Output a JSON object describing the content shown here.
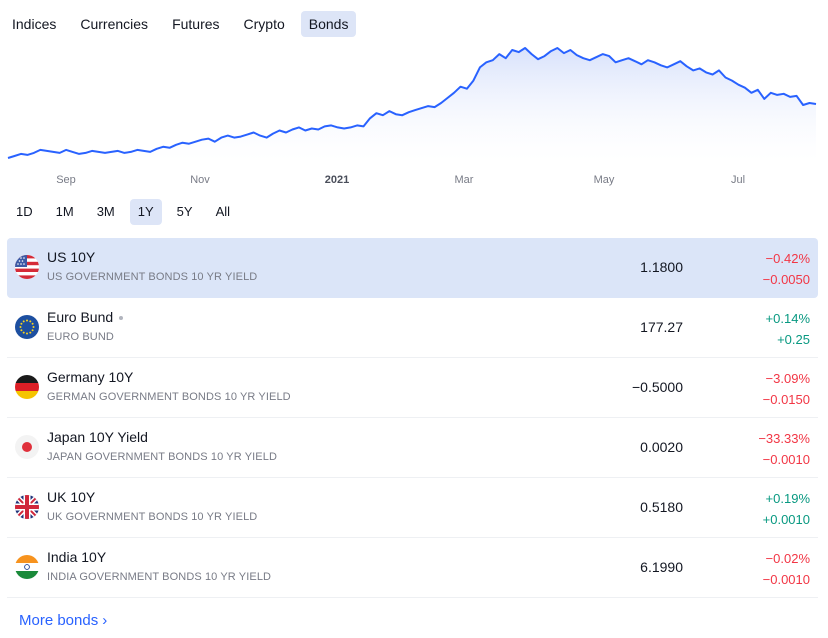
{
  "tabs": [
    {
      "label": "Indices"
    },
    {
      "label": "Currencies"
    },
    {
      "label": "Futures"
    },
    {
      "label": "Crypto"
    },
    {
      "label": "Bonds",
      "active": true
    }
  ],
  "chart_data": {
    "type": "area",
    "x_ticks": [
      "Sep",
      "Nov",
      "2021",
      "Mar",
      "May",
      "Jul"
    ],
    "line_color": "#2962ff",
    "fill_color": "#e8eefc",
    "values": [
      0.66,
      0.68,
      0.7,
      0.69,
      0.71,
      0.74,
      0.73,
      0.72,
      0.71,
      0.74,
      0.72,
      0.7,
      0.71,
      0.73,
      0.72,
      0.71,
      0.72,
      0.73,
      0.71,
      0.72,
      0.74,
      0.73,
      0.72,
      0.75,
      0.77,
      0.76,
      0.79,
      0.81,
      0.8,
      0.82,
      0.84,
      0.85,
      0.82,
      0.86,
      0.88,
      0.86,
      0.87,
      0.89,
      0.91,
      0.88,
      0.86,
      0.9,
      0.93,
      0.91,
      0.94,
      0.96,
      0.93,
      0.95,
      0.94,
      0.97,
      0.98,
      0.96,
      0.95,
      0.96,
      0.98,
      0.97,
      1.05,
      1.1,
      1.08,
      1.12,
      1.09,
      1.08,
      1.11,
      1.13,
      1.15,
      1.17,
      1.16,
      1.2,
      1.25,
      1.3,
      1.36,
      1.34,
      1.42,
      1.55,
      1.6,
      1.62,
      1.68,
      1.64,
      1.72,
      1.7,
      1.74,
      1.68,
      1.63,
      1.66,
      1.71,
      1.74,
      1.69,
      1.72,
      1.67,
      1.64,
      1.62,
      1.65,
      1.68,
      1.66,
      1.6,
      1.62,
      1.64,
      1.61,
      1.58,
      1.62,
      1.6,
      1.57,
      1.55,
      1.58,
      1.61,
      1.56,
      1.52,
      1.54,
      1.5,
      1.48,
      1.52,
      1.45,
      1.42,
      1.38,
      1.35,
      1.3,
      1.33,
      1.24,
      1.3,
      1.28,
      1.29,
      1.26,
      1.27,
      1.18,
      1.2,
      1.19
    ],
    "range_options": [
      "1D",
      "1M",
      "3M",
      "1Y",
      "5Y",
      "All"
    ],
    "selected_range": "1Y"
  },
  "bonds": [
    {
      "name": "US 10Y",
      "desc": "US GOVERNMENT BONDS 10 YR YIELD",
      "value": "1.1800",
      "chg_pct": "−0.42%",
      "chg_abs": "−0.0050",
      "positive": false,
      "flag": "us",
      "active": true,
      "dot": false
    },
    {
      "name": "Euro Bund",
      "desc": "EURO BUND",
      "value": "177.27",
      "chg_pct": "+0.14%",
      "chg_abs": "+0.25",
      "positive": true,
      "flag": "eu",
      "active": false,
      "dot": true
    },
    {
      "name": "Germany 10Y",
      "desc": "GERMAN GOVERNMENT BONDS 10 YR YIELD",
      "value": "−0.5000",
      "chg_pct": "−3.09%",
      "chg_abs": "−0.0150",
      "positive": false,
      "flag": "de",
      "active": false,
      "dot": false
    },
    {
      "name": "Japan 10Y Yield",
      "desc": "JAPAN GOVERNMENT BONDS 10 YR YIELD",
      "value": "0.0020",
      "chg_pct": "−33.33%",
      "chg_abs": "−0.0010",
      "positive": false,
      "flag": "jp",
      "active": false,
      "dot": false
    },
    {
      "name": "UK 10Y",
      "desc": "UK GOVERNMENT BONDS 10 YR YIELD",
      "value": "0.5180",
      "chg_pct": "+0.19%",
      "chg_abs": "+0.0010",
      "positive": true,
      "flag": "gb",
      "active": false,
      "dot": false
    },
    {
      "name": "India 10Y",
      "desc": "INDIA GOVERNMENT BONDS 10 YR YIELD",
      "value": "6.1990",
      "chg_pct": "−0.02%",
      "chg_abs": "−0.0010",
      "positive": false,
      "flag": "in",
      "active": false,
      "dot": false
    }
  ],
  "more_link": "More bonds",
  "colors": {
    "accent": "#2962ff",
    "negative": "#f23645",
    "positive": "#089981",
    "active_bg": "#dbe5f8"
  }
}
